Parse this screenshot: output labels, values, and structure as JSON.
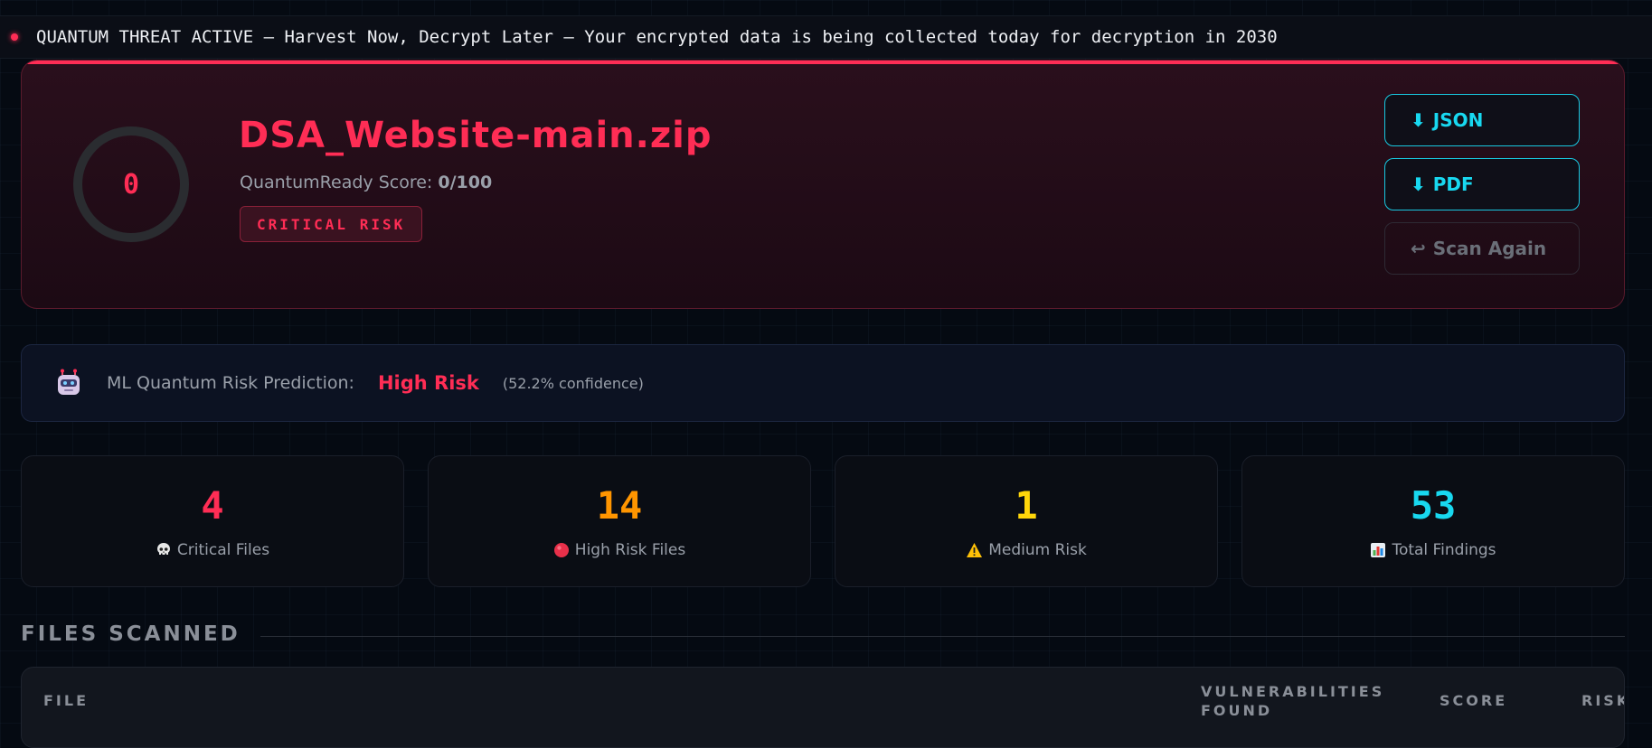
{
  "ticker": {
    "text": "QUANTUM THREAT ACTIVE — Harvest Now, Decrypt Later — Your encrypted data is being collected today for decryption in 2030"
  },
  "result": {
    "score_value": "0",
    "file_name": "DSA_Website-main.zip",
    "score_label": "QuantumReady Score:",
    "score_text": "0/100",
    "risk_level": "CRITICAL RISK",
    "score_percent": 0
  },
  "actions": {
    "json_label": "JSON",
    "pdf_label": "PDF",
    "scan_again_label": "Scan Again"
  },
  "ml": {
    "label": "ML Quantum Risk Prediction:",
    "prediction": "High Risk",
    "confidence": "(52.2% confidence)"
  },
  "stats": [
    {
      "value": "4",
      "label": "Critical Files",
      "icon": "skull-icon",
      "color": "#ff2d55"
    },
    {
      "value": "14",
      "label": "High Risk Files",
      "icon": "red-circle-icon",
      "color": "#ff9500"
    },
    {
      "value": "1",
      "label": "Medium Risk",
      "icon": "warning-icon",
      "color": "#ffd60a"
    },
    {
      "value": "53",
      "label": "Total Findings",
      "icon": "bar-chart-icon",
      "color": "#18d8f0"
    }
  ],
  "files_section": {
    "title": "FILES SCANNED",
    "columns": {
      "file": "FILE",
      "vulnerabilities": "VULNERABILITIES FOUND",
      "score": "SCORE",
      "risk": "RISK"
    }
  },
  "colors": {
    "critical": "#ff2d55",
    "accent_cyan": "#18d8f0",
    "background": "#050a12"
  }
}
